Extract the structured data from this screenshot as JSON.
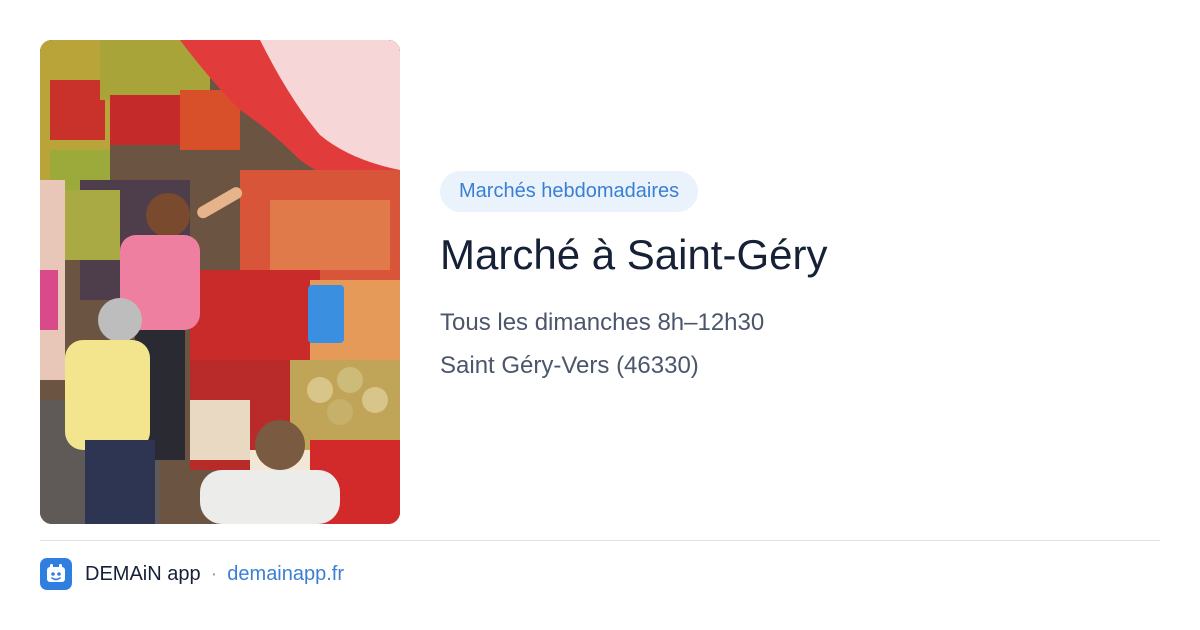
{
  "card": {
    "image_alt": "Étals de fruits et légumes au marché",
    "category": "Marchés hebdomadaires",
    "title": "Marché à Saint-Géry",
    "schedule": "Tous les dimanches 8h–12h30",
    "location": "Saint Géry-Vers (46330)"
  },
  "footer": {
    "app_name": "DEMAiN app",
    "separator": "·",
    "site": "demainapp.fr",
    "logo_icon": "demain-app-logo-icon"
  },
  "colors": {
    "accent": "#3b7fd4",
    "badge_bg": "#eaf2fc",
    "title": "#162036",
    "meta": "#4b566b",
    "logo_bg": "#2f7fe0"
  }
}
